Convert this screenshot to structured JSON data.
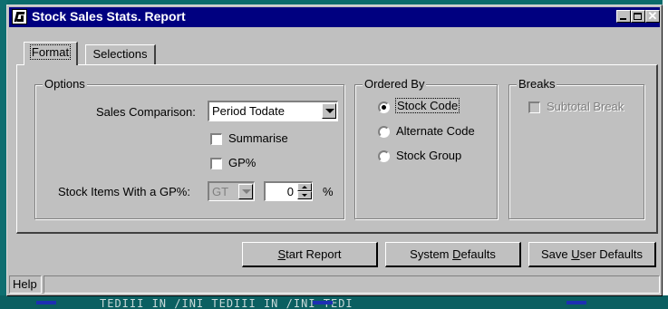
{
  "window": {
    "title": "Stock Sales Stats. Report",
    "controls": {
      "minimize": "",
      "maximize": "",
      "close": "✕"
    }
  },
  "tabs": [
    {
      "label": "Format",
      "active": true
    },
    {
      "label": "Selections",
      "active": false
    }
  ],
  "options": {
    "group_label": "Options",
    "sales_comparison_label": "Sales Comparison:",
    "sales_comparison_value": "Period Todate",
    "summarise_label": "Summarise",
    "summarise_checked": false,
    "gp_label": "GP%",
    "gp_checked": false,
    "gp_filter_label": "Stock Items With a GP%:",
    "gp_operator_value": "GT",
    "gp_value": "0",
    "gp_unit": "%"
  },
  "ordered_by": {
    "group_label": "Ordered By",
    "options": [
      {
        "label": "Stock Code",
        "selected": true
      },
      {
        "label": "Alternate Code",
        "selected": false
      },
      {
        "label": "Stock Group",
        "selected": false
      }
    ]
  },
  "breaks": {
    "group_label": "Breaks",
    "subtotal_break_label": "Subtotal Break",
    "subtotal_break_checked": false,
    "enabled": false
  },
  "buttons": {
    "start_report": {
      "pre": "",
      "accel": "S",
      "post": "tart Report"
    },
    "system_defaults": {
      "pre": "System ",
      "accel": "D",
      "post": "efaults"
    },
    "save_user_defaults": {
      "pre": "Save ",
      "accel": "U",
      "post": "ser Defaults"
    }
  },
  "statusbar": {
    "help": "Help",
    "message": ""
  },
  "background_text": "TEDIII IN /INI    TEDIII IN /INI    TEDI"
}
